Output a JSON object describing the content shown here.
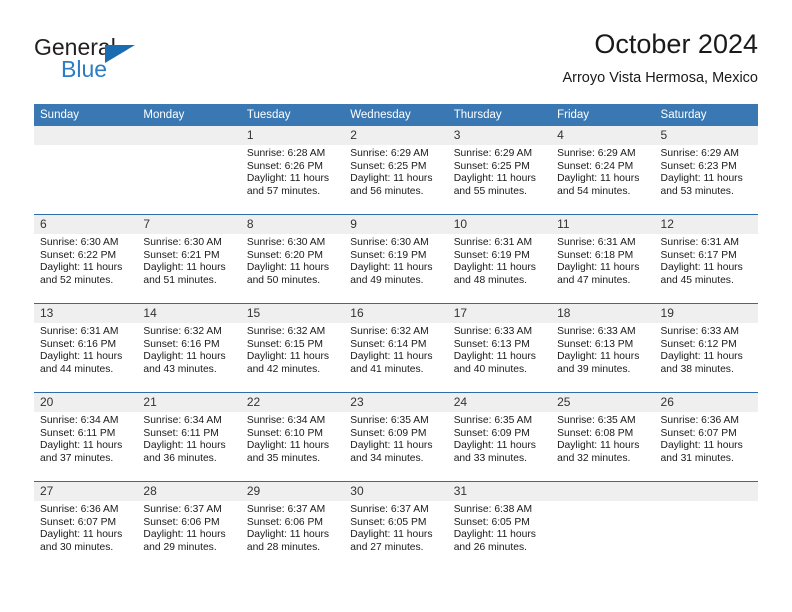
{
  "brand": {
    "name_part1": "General",
    "name_part2": "Blue",
    "triangle_icon": "triangle-icon",
    "accent_color": "#2e7cc3"
  },
  "header": {
    "title": "October 2024",
    "subtitle": "Arroyo Vista Hermosa, Mexico"
  },
  "theme": {
    "header_blue": "#3a78b4",
    "row_divider_blue": "#2f6da8",
    "daynum_band": "#efefef"
  },
  "calendar": {
    "weekday_headers": [
      "Sunday",
      "Monday",
      "Tuesday",
      "Wednesday",
      "Thursday",
      "Friday",
      "Saturday"
    ],
    "weeks": [
      [
        {
          "day": "",
          "sunrise": "",
          "sunset": "",
          "daylight_line1": "",
          "daylight_line2": "",
          "empty": true
        },
        {
          "day": "",
          "sunrise": "",
          "sunset": "",
          "daylight_line1": "",
          "daylight_line2": "",
          "empty": true
        },
        {
          "day": "1",
          "sunrise": "Sunrise: 6:28 AM",
          "sunset": "Sunset: 6:26 PM",
          "daylight_line1": "Daylight: 11 hours",
          "daylight_line2": "and 57 minutes.",
          "empty": false
        },
        {
          "day": "2",
          "sunrise": "Sunrise: 6:29 AM",
          "sunset": "Sunset: 6:25 PM",
          "daylight_line1": "Daylight: 11 hours",
          "daylight_line2": "and 56 minutes.",
          "empty": false
        },
        {
          "day": "3",
          "sunrise": "Sunrise: 6:29 AM",
          "sunset": "Sunset: 6:25 PM",
          "daylight_line1": "Daylight: 11 hours",
          "daylight_line2": "and 55 minutes.",
          "empty": false
        },
        {
          "day": "4",
          "sunrise": "Sunrise: 6:29 AM",
          "sunset": "Sunset: 6:24 PM",
          "daylight_line1": "Daylight: 11 hours",
          "daylight_line2": "and 54 minutes.",
          "empty": false
        },
        {
          "day": "5",
          "sunrise": "Sunrise: 6:29 AM",
          "sunset": "Sunset: 6:23 PM",
          "daylight_line1": "Daylight: 11 hours",
          "daylight_line2": "and 53 minutes.",
          "empty": false
        }
      ],
      [
        {
          "day": "6",
          "sunrise": "Sunrise: 6:30 AM",
          "sunset": "Sunset: 6:22 PM",
          "daylight_line1": "Daylight: 11 hours",
          "daylight_line2": "and 52 minutes.",
          "empty": false
        },
        {
          "day": "7",
          "sunrise": "Sunrise: 6:30 AM",
          "sunset": "Sunset: 6:21 PM",
          "daylight_line1": "Daylight: 11 hours",
          "daylight_line2": "and 51 minutes.",
          "empty": false
        },
        {
          "day": "8",
          "sunrise": "Sunrise: 6:30 AM",
          "sunset": "Sunset: 6:20 PM",
          "daylight_line1": "Daylight: 11 hours",
          "daylight_line2": "and 50 minutes.",
          "empty": false
        },
        {
          "day": "9",
          "sunrise": "Sunrise: 6:30 AM",
          "sunset": "Sunset: 6:19 PM",
          "daylight_line1": "Daylight: 11 hours",
          "daylight_line2": "and 49 minutes.",
          "empty": false
        },
        {
          "day": "10",
          "sunrise": "Sunrise: 6:31 AM",
          "sunset": "Sunset: 6:19 PM",
          "daylight_line1": "Daylight: 11 hours",
          "daylight_line2": "and 48 minutes.",
          "empty": false
        },
        {
          "day": "11",
          "sunrise": "Sunrise: 6:31 AM",
          "sunset": "Sunset: 6:18 PM",
          "daylight_line1": "Daylight: 11 hours",
          "daylight_line2": "and 47 minutes.",
          "empty": false
        },
        {
          "day": "12",
          "sunrise": "Sunrise: 6:31 AM",
          "sunset": "Sunset: 6:17 PM",
          "daylight_line1": "Daylight: 11 hours",
          "daylight_line2": "and 45 minutes.",
          "empty": false
        }
      ],
      [
        {
          "day": "13",
          "sunrise": "Sunrise: 6:31 AM",
          "sunset": "Sunset: 6:16 PM",
          "daylight_line1": "Daylight: 11 hours",
          "daylight_line2": "and 44 minutes.",
          "empty": false
        },
        {
          "day": "14",
          "sunrise": "Sunrise: 6:32 AM",
          "sunset": "Sunset: 6:16 PM",
          "daylight_line1": "Daylight: 11 hours",
          "daylight_line2": "and 43 minutes.",
          "empty": false
        },
        {
          "day": "15",
          "sunrise": "Sunrise: 6:32 AM",
          "sunset": "Sunset: 6:15 PM",
          "daylight_line1": "Daylight: 11 hours",
          "daylight_line2": "and 42 minutes.",
          "empty": false
        },
        {
          "day": "16",
          "sunrise": "Sunrise: 6:32 AM",
          "sunset": "Sunset: 6:14 PM",
          "daylight_line1": "Daylight: 11 hours",
          "daylight_line2": "and 41 minutes.",
          "empty": false
        },
        {
          "day": "17",
          "sunrise": "Sunrise: 6:33 AM",
          "sunset": "Sunset: 6:13 PM",
          "daylight_line1": "Daylight: 11 hours",
          "daylight_line2": "and 40 minutes.",
          "empty": false
        },
        {
          "day": "18",
          "sunrise": "Sunrise: 6:33 AM",
          "sunset": "Sunset: 6:13 PM",
          "daylight_line1": "Daylight: 11 hours",
          "daylight_line2": "and 39 minutes.",
          "empty": false
        },
        {
          "day": "19",
          "sunrise": "Sunrise: 6:33 AM",
          "sunset": "Sunset: 6:12 PM",
          "daylight_line1": "Daylight: 11 hours",
          "daylight_line2": "and 38 minutes.",
          "empty": false
        }
      ],
      [
        {
          "day": "20",
          "sunrise": "Sunrise: 6:34 AM",
          "sunset": "Sunset: 6:11 PM",
          "daylight_line1": "Daylight: 11 hours",
          "daylight_line2": "and 37 minutes.",
          "empty": false
        },
        {
          "day": "21",
          "sunrise": "Sunrise: 6:34 AM",
          "sunset": "Sunset: 6:11 PM",
          "daylight_line1": "Daylight: 11 hours",
          "daylight_line2": "and 36 minutes.",
          "empty": false
        },
        {
          "day": "22",
          "sunrise": "Sunrise: 6:34 AM",
          "sunset": "Sunset: 6:10 PM",
          "daylight_line1": "Daylight: 11 hours",
          "daylight_line2": "and 35 minutes.",
          "empty": false
        },
        {
          "day": "23",
          "sunrise": "Sunrise: 6:35 AM",
          "sunset": "Sunset: 6:09 PM",
          "daylight_line1": "Daylight: 11 hours",
          "daylight_line2": "and 34 minutes.",
          "empty": false
        },
        {
          "day": "24",
          "sunrise": "Sunrise: 6:35 AM",
          "sunset": "Sunset: 6:09 PM",
          "daylight_line1": "Daylight: 11 hours",
          "daylight_line2": "and 33 minutes.",
          "empty": false
        },
        {
          "day": "25",
          "sunrise": "Sunrise: 6:35 AM",
          "sunset": "Sunset: 6:08 PM",
          "daylight_line1": "Daylight: 11 hours",
          "daylight_line2": "and 32 minutes.",
          "empty": false
        },
        {
          "day": "26",
          "sunrise": "Sunrise: 6:36 AM",
          "sunset": "Sunset: 6:07 PM",
          "daylight_line1": "Daylight: 11 hours",
          "daylight_line2": "and 31 minutes.",
          "empty": false
        }
      ],
      [
        {
          "day": "27",
          "sunrise": "Sunrise: 6:36 AM",
          "sunset": "Sunset: 6:07 PM",
          "daylight_line1": "Daylight: 11 hours",
          "daylight_line2": "and 30 minutes.",
          "empty": false
        },
        {
          "day": "28",
          "sunrise": "Sunrise: 6:37 AM",
          "sunset": "Sunset: 6:06 PM",
          "daylight_line1": "Daylight: 11 hours",
          "daylight_line2": "and 29 minutes.",
          "empty": false
        },
        {
          "day": "29",
          "sunrise": "Sunrise: 6:37 AM",
          "sunset": "Sunset: 6:06 PM",
          "daylight_line1": "Daylight: 11 hours",
          "daylight_line2": "and 28 minutes.",
          "empty": false
        },
        {
          "day": "30",
          "sunrise": "Sunrise: 6:37 AM",
          "sunset": "Sunset: 6:05 PM",
          "daylight_line1": "Daylight: 11 hours",
          "daylight_line2": "and 27 minutes.",
          "empty": false
        },
        {
          "day": "31",
          "sunrise": "Sunrise: 6:38 AM",
          "sunset": "Sunset: 6:05 PM",
          "daylight_line1": "Daylight: 11 hours",
          "daylight_line2": "and 26 minutes.",
          "empty": false
        },
        {
          "day": "",
          "sunrise": "",
          "sunset": "",
          "daylight_line1": "",
          "daylight_line2": "",
          "empty": true
        },
        {
          "day": "",
          "sunrise": "",
          "sunset": "",
          "daylight_line1": "",
          "daylight_line2": "",
          "empty": true
        }
      ]
    ]
  }
}
